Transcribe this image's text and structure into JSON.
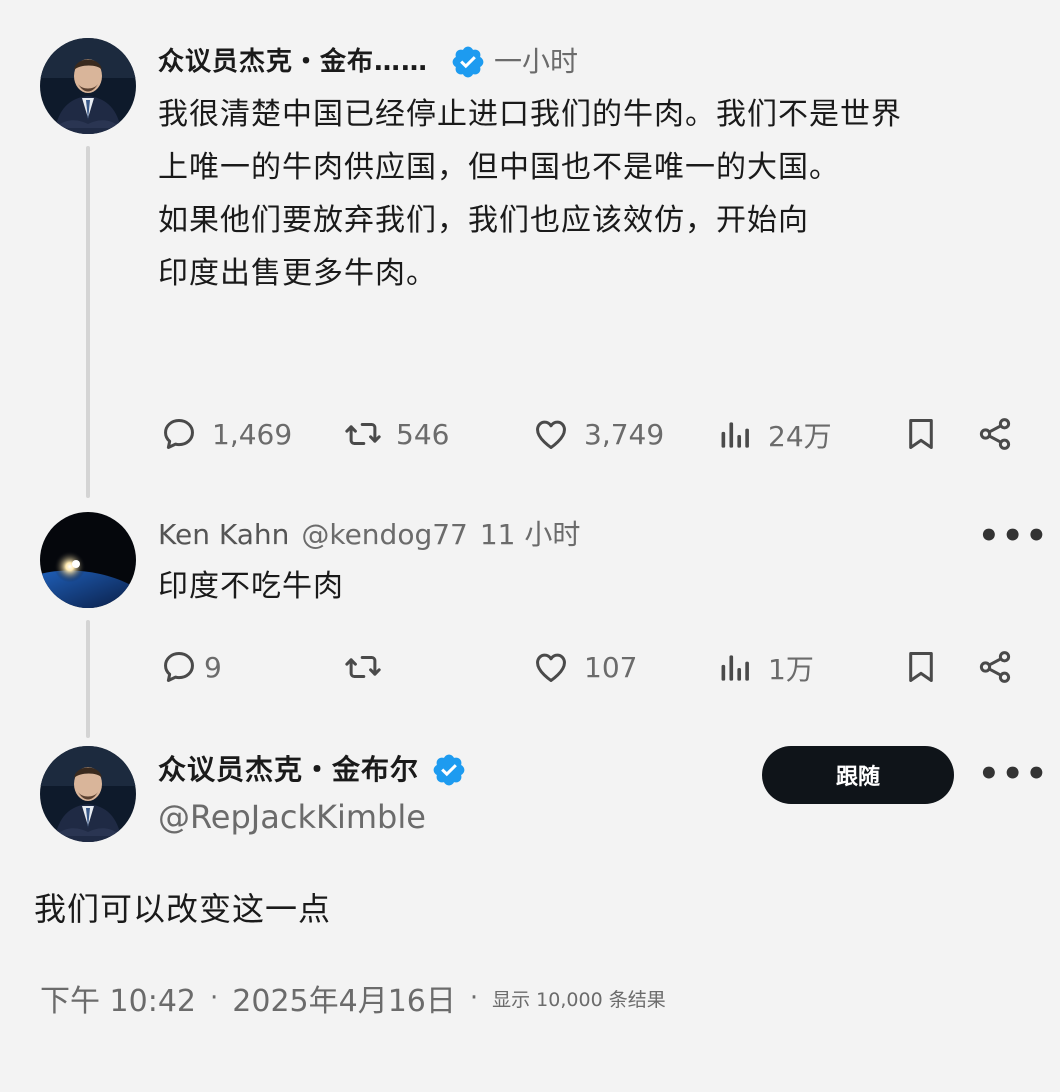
{
  "post1": {
    "author_name": "众议员杰克・金布……",
    "time": "一小时",
    "text_lines": [
      "我很清楚中国已经停止进口我们的牛肉。我们不是世界",
      "上唯一的牛肉供应国，但中国也不是唯一的大国。",
      "如果他们要放弃我们，我们也应该效仿，开始向",
      "印度出售更多牛肉。"
    ],
    "replies": "1,469",
    "reposts": "546",
    "likes": "3,749",
    "views": "24万"
  },
  "post2": {
    "author_name": "Ken Kahn",
    "handle": "@kendog77",
    "time": "11 小时",
    "text": "印度不吃牛肉",
    "replies": "9",
    "reposts": "",
    "likes": "107",
    "views": "1万"
  },
  "post3": {
    "author_name": "众议员杰克・金布尔",
    "handle": "@RepJackKimble",
    "follow_label": "跟随",
    "text": "我们可以改变这一点",
    "time": "下午 10:42",
    "date": "2025年4月16日",
    "views_label": "显示 10,000 条结果"
  },
  "colors": {
    "background": "#f3f3f3",
    "verified_blue": "#1d9bf0",
    "muted_text": "#6b6b6b",
    "follow_button": "#0f1419"
  },
  "icons": [
    "reply-icon",
    "repost-icon",
    "like-icon",
    "views-icon",
    "bookmark-icon",
    "share-icon",
    "verified-icon",
    "more-icon"
  ]
}
